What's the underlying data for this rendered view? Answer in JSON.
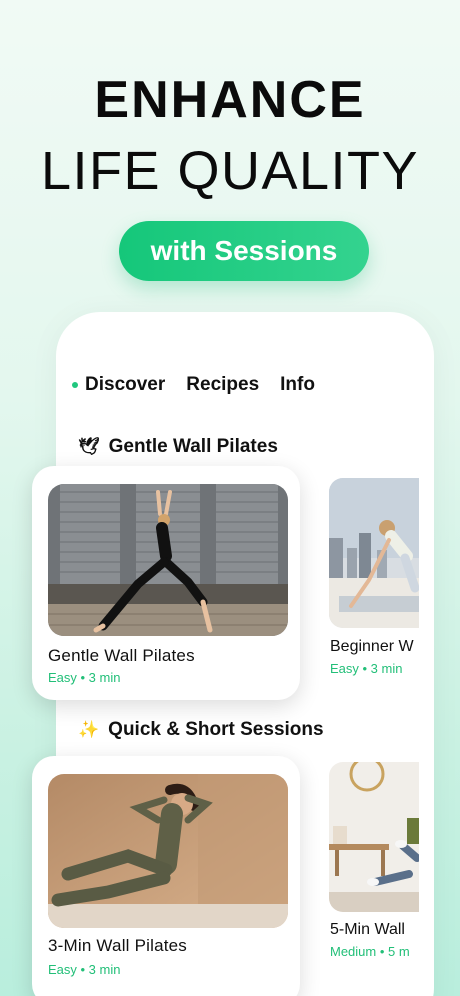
{
  "headline": {
    "line1": "ENHANCE",
    "line2": "LIFE QUALITY"
  },
  "badge": {
    "label": "with Sessions"
  },
  "tabs": [
    {
      "label": "Discover",
      "active": true
    },
    {
      "label": "Recipes",
      "active": false
    },
    {
      "label": "Info",
      "active": false
    }
  ],
  "sections": [
    {
      "icon": "dove-icon",
      "emoji": "🕊",
      "title": "Gentle Wall Pilates",
      "cards": [
        {
          "title": "Gentle Wall Pilates",
          "meta": "Easy • 3 min"
        },
        {
          "title": "Beginner W",
          "meta": "Easy • 3 min"
        }
      ]
    },
    {
      "icon": "sparkles-icon",
      "emoji": "✨",
      "title": "Quick & Short Sessions",
      "cards": [
        {
          "title": "3-Min Wall Pilates",
          "meta": "Easy • 3 min"
        },
        {
          "title": "5-Min Wall",
          "meta": "Medium • 5 m"
        }
      ]
    }
  ],
  "colors": {
    "accent": "#1fc77d",
    "background": "#e3f7ee"
  }
}
